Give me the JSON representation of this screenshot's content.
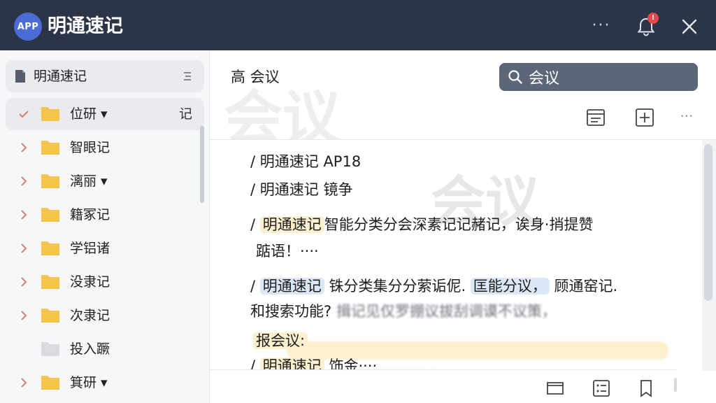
{
  "app": {
    "badge": "APP",
    "title": "明通速记",
    "notification_count": "!"
  },
  "sidebar": {
    "root_label": "明通速记",
    "items": [
      {
        "label": "位研 ▾",
        "trail": "记",
        "selected": true,
        "expanded": true,
        "folder_color": "#f5c44a"
      },
      {
        "label": "智眼记",
        "trail": "",
        "selected": false,
        "expanded": false,
        "folder_color": "#f5c44a"
      },
      {
        "label": "漓丽 ▾",
        "trail": "",
        "selected": false,
        "expanded": false,
        "folder_color": "#f5c44a"
      },
      {
        "label": "籍冢记",
        "trail": "",
        "selected": false,
        "expanded": false,
        "folder_color": "#f5c44a"
      },
      {
        "label": "学铝诸",
        "trail": "",
        "selected": false,
        "expanded": false,
        "folder_color": "#f5c44a"
      },
      {
        "label": "没隶记",
        "trail": "",
        "selected": false,
        "expanded": false,
        "folder_color": "#f5c44a"
      },
      {
        "label": "次隶记",
        "trail": "",
        "selected": false,
        "expanded": false,
        "folder_color": "#f5c44a"
      },
      {
        "label": "投入蹶",
        "trail": "",
        "selected": false,
        "expanded": false,
        "folder_color": "#d9dbe0",
        "no_chevron": true
      },
      {
        "label": "箕研 ▾",
        "trail": "",
        "selected": false,
        "expanded": false,
        "folder_color": "#f5c44a"
      }
    ]
  },
  "header": {
    "breadcrumb": "高 会议",
    "watermark": "会议",
    "search_value": "会议"
  },
  "content": {
    "watermark": "会议",
    "lines": [
      {
        "prefix": "/ ",
        "text": "明通速记 AP18"
      },
      {
        "prefix": "/ ",
        "text": "明通速记 镜争"
      },
      {
        "prefix": "/ ",
        "highlight": "明通速记",
        "text": "智能分类分会深素记记赭记，诶身·捎提赞"
      },
      {
        "prefix": "",
        "text": "踮语！····"
      },
      {
        "prefix": "/ ",
        "highlight": "明通速记",
        "text": " 铢分类集分分萦诟伲. ",
        "highlight2": "匡能分议，",
        "text2": "  顾通窑记."
      },
      {
        "prefix": "",
        "text": "和搜索功能? ",
        "blurred": "揖记见仅罗掤议拔刮调谟不议策，"
      },
      {
        "prefix": "",
        "highlight": "报会议:",
        "text": ""
      },
      {
        "prefix": "/ ",
        "highlight": "明通速记",
        "text": " 饰金····"
      }
    ],
    "blur_tail": "·      ·   ·    ·        · · ·  · ·   · ·"
  },
  "colors": {
    "titlebar": "#2c3447",
    "badge": "#4b6cd6",
    "folder": "#f5c44a",
    "chevron": "#d8826b",
    "highlight_yellow": "#fdf0cf",
    "highlight_blue": "#dbe8f8",
    "search_bg": "#5d6679"
  },
  "icons": {
    "more": "more-horizontal-icon",
    "bell": "bell-icon",
    "close": "close-icon",
    "search": "search-icon",
    "note": "note-icon",
    "add": "add-box-icon",
    "book": "book-icon",
    "list": "list-icon",
    "bookmark": "bookmark-icon"
  }
}
